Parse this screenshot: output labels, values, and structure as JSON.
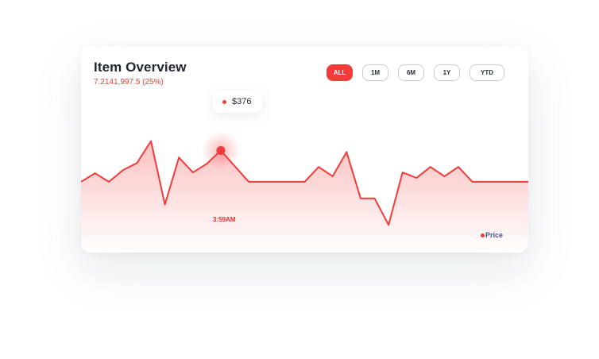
{
  "header": {
    "title": "Item Overview",
    "subtitle": "7.2141,997.5 (25%)"
  },
  "ranges": [
    {
      "label": "ALL",
      "active": true
    },
    {
      "label": "1M",
      "active": false
    },
    {
      "label": "6M",
      "active": false
    },
    {
      "label": "1Y",
      "active": false
    },
    {
      "label": "YTD",
      "active": false
    }
  ],
  "tooltip": {
    "value": "$376",
    "time": "3:59AM"
  },
  "colors": {
    "accent": "#f23b3b",
    "text": "#1f2430",
    "legend_text": "#4b4f8f"
  },
  "chart_data": {
    "type": "area",
    "series": [
      {
        "name": "Price",
        "values": [
          0,
          11,
          0,
          15,
          24,
          52,
          -29,
          31,
          12,
          23,
          40,
          20,
          0,
          0,
          0,
          0,
          0,
          19,
          7,
          38,
          -21,
          -21,
          -55,
          12,
          5,
          19,
          7,
          19,
          0,
          0,
          0,
          0,
          0
        ]
      }
    ],
    "highlight_index": 10,
    "ylim": [
      -70,
      80
    ],
    "grid": false,
    "legend": "bottom-right"
  }
}
